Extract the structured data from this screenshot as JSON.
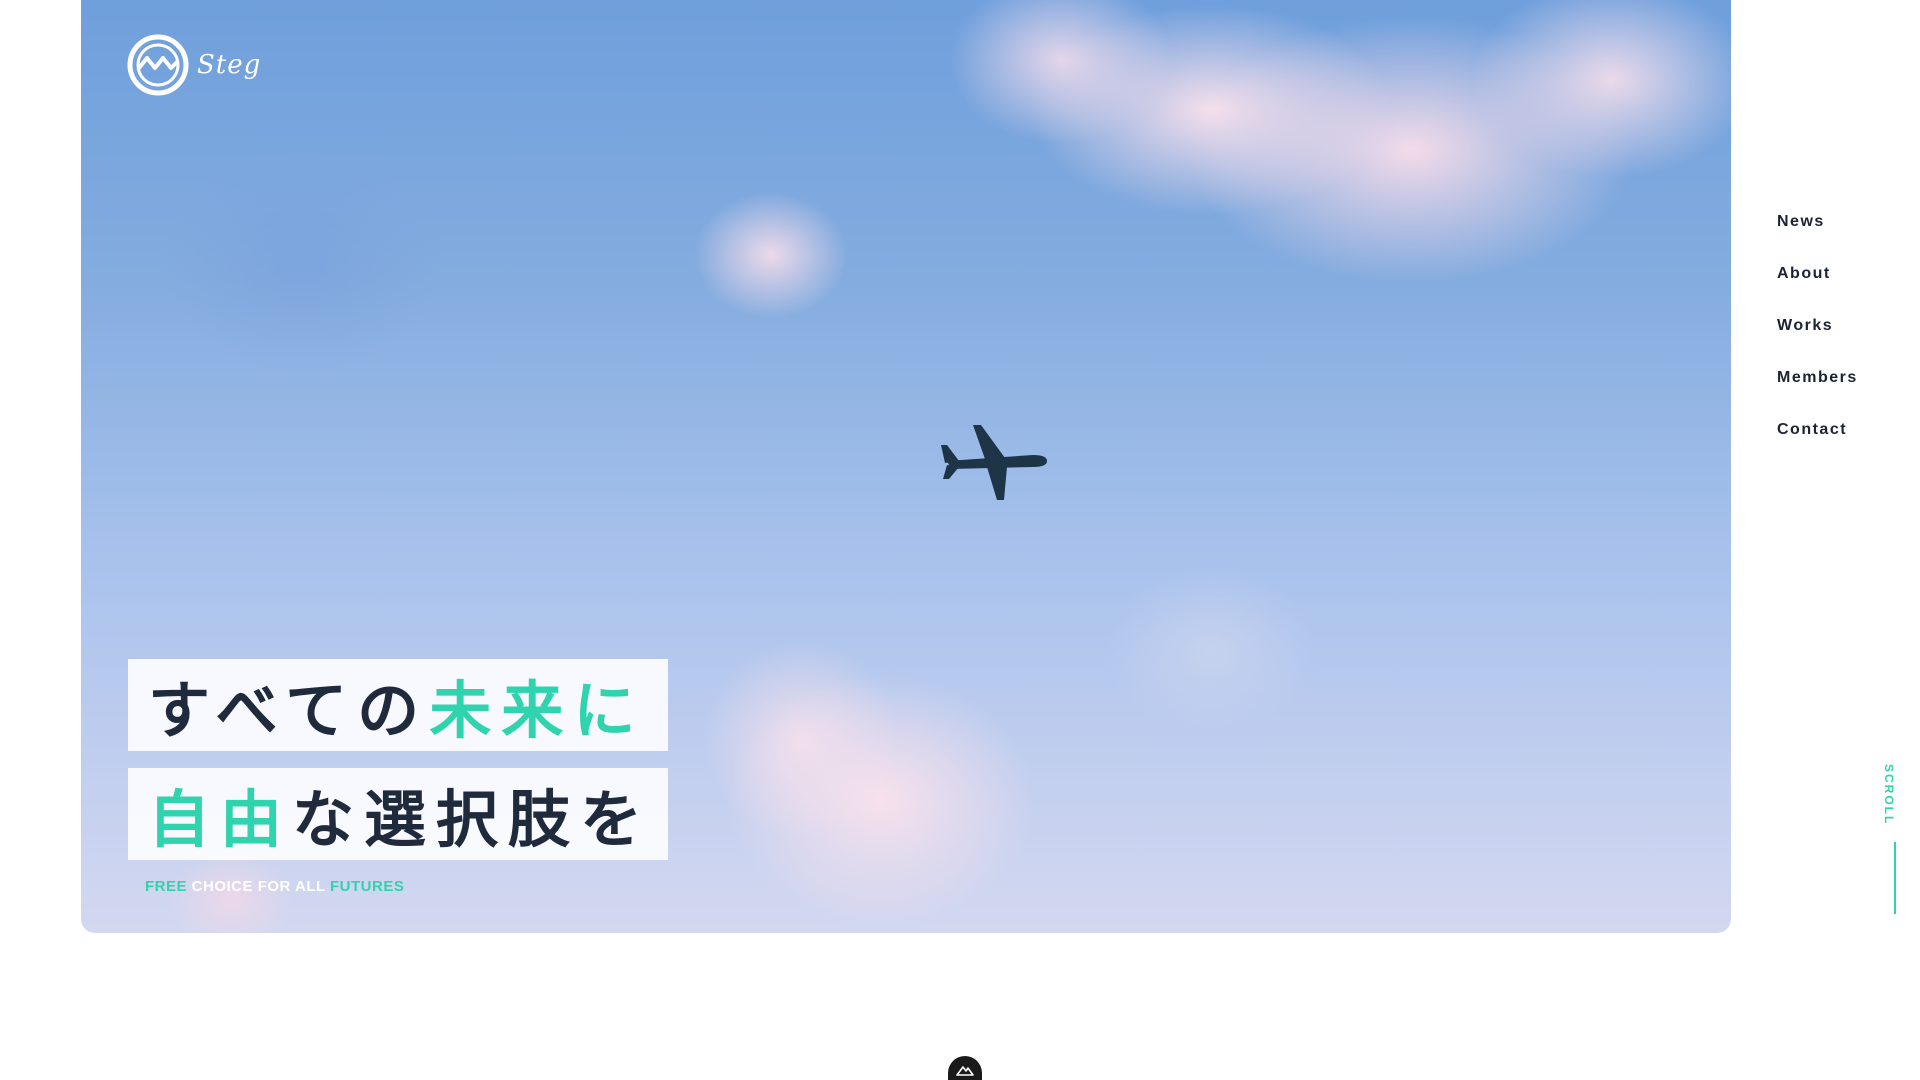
{
  "brand": {
    "name": "Steg",
    "icon": "steg-wave-logo"
  },
  "hero": {
    "image": "sky-with-airplane",
    "headline_line1": {
      "part1": "すべての",
      "accent": "未来に"
    },
    "headline_line2": {
      "accent": "自由",
      "part2": "な選択肢を"
    },
    "tagline": {
      "word1": "FREE",
      "middle": " CHOICE FOR ALL ",
      "word2": "FUTURES"
    }
  },
  "nav": {
    "items": [
      {
        "label": "News"
      },
      {
        "label": "About"
      },
      {
        "label": "Works"
      },
      {
        "label": "Members"
      },
      {
        "label": "Contact"
      }
    ]
  },
  "scroll": {
    "label": "SCROLL"
  },
  "colors": {
    "accent": "#2fd3ad",
    "text_dark": "#1f2a3c",
    "badge": "#1a1a1a"
  }
}
